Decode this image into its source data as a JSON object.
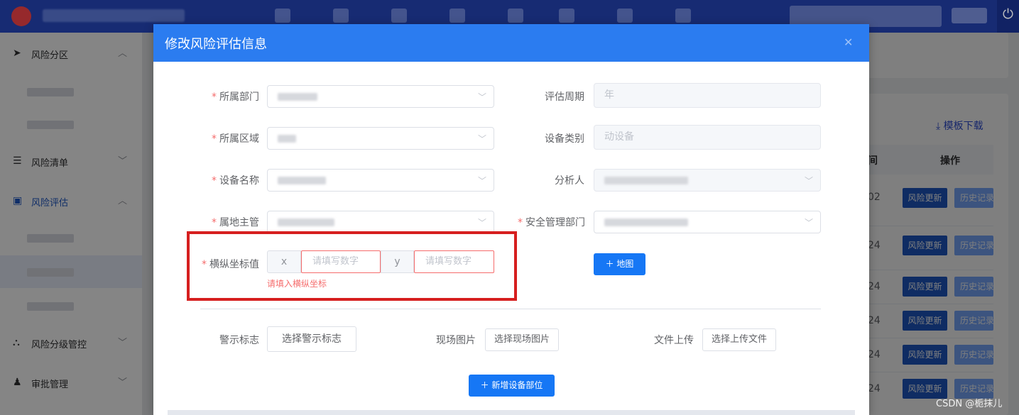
{
  "topbar": {
    "power_icon": "power-icon"
  },
  "sidebar": {
    "items": [
      {
        "label": "风险分区",
        "icon": "send-icon",
        "expanded": true
      },
      {
        "label": "风险清单",
        "icon": "list-icon",
        "expanded": false
      },
      {
        "label": "风险评估",
        "icon": "monitor-icon",
        "expanded": true,
        "active": true
      },
      {
        "label": "风险分级管控",
        "icon": "hierarchy-icon",
        "expanded": false
      },
      {
        "label": "审批管理",
        "icon": "bell-icon",
        "expanded": false
      }
    ]
  },
  "content": {
    "template_download": "模板下载",
    "table": {
      "headers": [
        "时间",
        "操作"
      ],
      "rows": [
        {
          "time_suffix": "02",
          "update_btn": "风险更新",
          "history_btn": "历史记录"
        },
        {
          "time_suffix": "24",
          "update_btn": "风险更新",
          "history_btn": "历史记录"
        },
        {
          "time_suffix": "24",
          "update_btn": "风险更新",
          "history_btn": "历史记录"
        },
        {
          "time_suffix": "24",
          "update_btn": "风险更新",
          "history_btn": "历史记录"
        },
        {
          "time_suffix": "24",
          "update_btn": "风险更新",
          "history_btn": "历史记录"
        },
        {
          "time_suffix": "24",
          "update_btn": "风险更新",
          "history_btn": "历史记录"
        }
      ]
    }
  },
  "dialog": {
    "title": "修改风险评估信息",
    "close_icon": "close-icon",
    "fields": {
      "department": {
        "label": "所属部门",
        "required": true
      },
      "area": {
        "label": "所属区域",
        "required": true
      },
      "device_name": {
        "label": "设备名称",
        "required": true
      },
      "supervisor": {
        "label": "属地主管",
        "required": true
      },
      "cycle": {
        "label": "评估周期",
        "value": "年"
      },
      "device_category": {
        "label": "设备类别",
        "value": "动设备"
      },
      "analyst": {
        "label": "分析人"
      },
      "safety_dept": {
        "label": "安全管理部门",
        "required": true
      },
      "coords": {
        "label": "横纵坐标值",
        "required": true,
        "x_prefix": "x",
        "y_prefix": "y",
        "x_placeholder": "请填写数字",
        "y_placeholder": "请填写数字",
        "error": "请填入横纵坐标"
      }
    },
    "map_button": "地图",
    "warning_sign": {
      "label": "警示标志",
      "button": "选择警示标志"
    },
    "site_photo": {
      "label": "现场图片",
      "button": "选择现场图片"
    },
    "file_upload": {
      "label": "文件上传",
      "button": "选择上传文件"
    },
    "add_part_button": "新增设备部位"
  },
  "watermark": "CSDN @栀抹儿",
  "colors": {
    "header": "#2b7cf0",
    "primary": "#1677f5",
    "error": "#f56c6c",
    "highlight": "#d61f1f"
  }
}
